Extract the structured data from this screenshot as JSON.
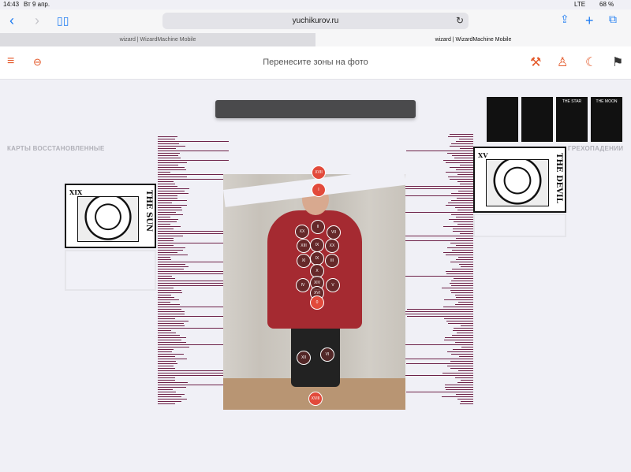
{
  "status": {
    "time": "14:43",
    "date": "Вт 9 апр.",
    "network": "LTE",
    "battery": "68 %"
  },
  "browser": {
    "url": "yuchikurov.ru"
  },
  "tabs": [
    {
      "label": "wizard | WizardMachine Mobile"
    },
    {
      "label": "wizard | WizardMachine Mobile"
    }
  ],
  "app": {
    "title": "Перенесите зоны на фото"
  },
  "labels": {
    "left": "КАРТЫ ВОССТАНОВЛЕННЫЕ",
    "right": "ГРЕХОПАДЕНИИ"
  },
  "cards": {
    "left": {
      "roman": "XIX",
      "name": "THE SUN"
    },
    "right": {
      "roman": "XV",
      "name": "THE DEVIL"
    }
  },
  "thumbs": [
    {
      "name": ""
    },
    {
      "name": ""
    },
    {
      "name": "THE STAR"
    },
    {
      "name": "THE MOON"
    }
  ],
  "markers": [
    "XVII",
    "I",
    "XX",
    "II",
    "VII",
    "XIII",
    "IX",
    "XX",
    "XI",
    "IX",
    "III",
    "X",
    "IV",
    "XIV",
    "V",
    "XVI",
    "0",
    "XII",
    "VI",
    "XVIII"
  ],
  "colors": {
    "accent": "#e45a2b",
    "spectrum": "#6d2148",
    "marker_red": "#e24a3b"
  }
}
